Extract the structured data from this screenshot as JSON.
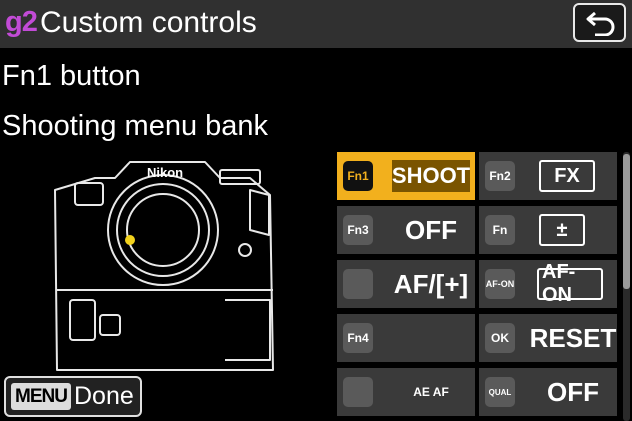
{
  "header": {
    "menu_code": "g2",
    "title": "Custom controls",
    "back_icon": "return-arrow-icon"
  },
  "subtitle": {
    "line1": "Fn1 button",
    "line2": "Shooting menu bank"
  },
  "camera": {
    "brand": "Nikon"
  },
  "grid": {
    "items": [
      {
        "icon_label": "Fn1",
        "value": "SHOOT",
        "selected": true
      },
      {
        "icon_label": "Fn2",
        "value": "FX",
        "selected": false
      },
      {
        "icon_label": "Fn3",
        "value": "OFF",
        "selected": false
      },
      {
        "icon_label": "Fn",
        "value": "±",
        "selected": false
      },
      {
        "icon_label": "",
        "value": "AF/[+]",
        "selected": false
      },
      {
        "icon_label": "AF-ON",
        "value": "AF-ON",
        "selected": false
      },
      {
        "icon_label": "Fn4",
        "value": "",
        "selected": false
      },
      {
        "icon_label": "OK",
        "value": "RESET",
        "selected": false
      },
      {
        "icon_label": "",
        "value": "AE AF",
        "selected": false
      },
      {
        "icon_label": "QUAL",
        "value": "OFF",
        "selected": false
      }
    ]
  },
  "footer": {
    "menu_badge": "MENU",
    "done_label": "Done"
  },
  "colors": {
    "accent": "#f2b01d",
    "menu_code": "#c24bd6",
    "header_bg": "#303030",
    "cell_bg": "#3a3a3a"
  }
}
